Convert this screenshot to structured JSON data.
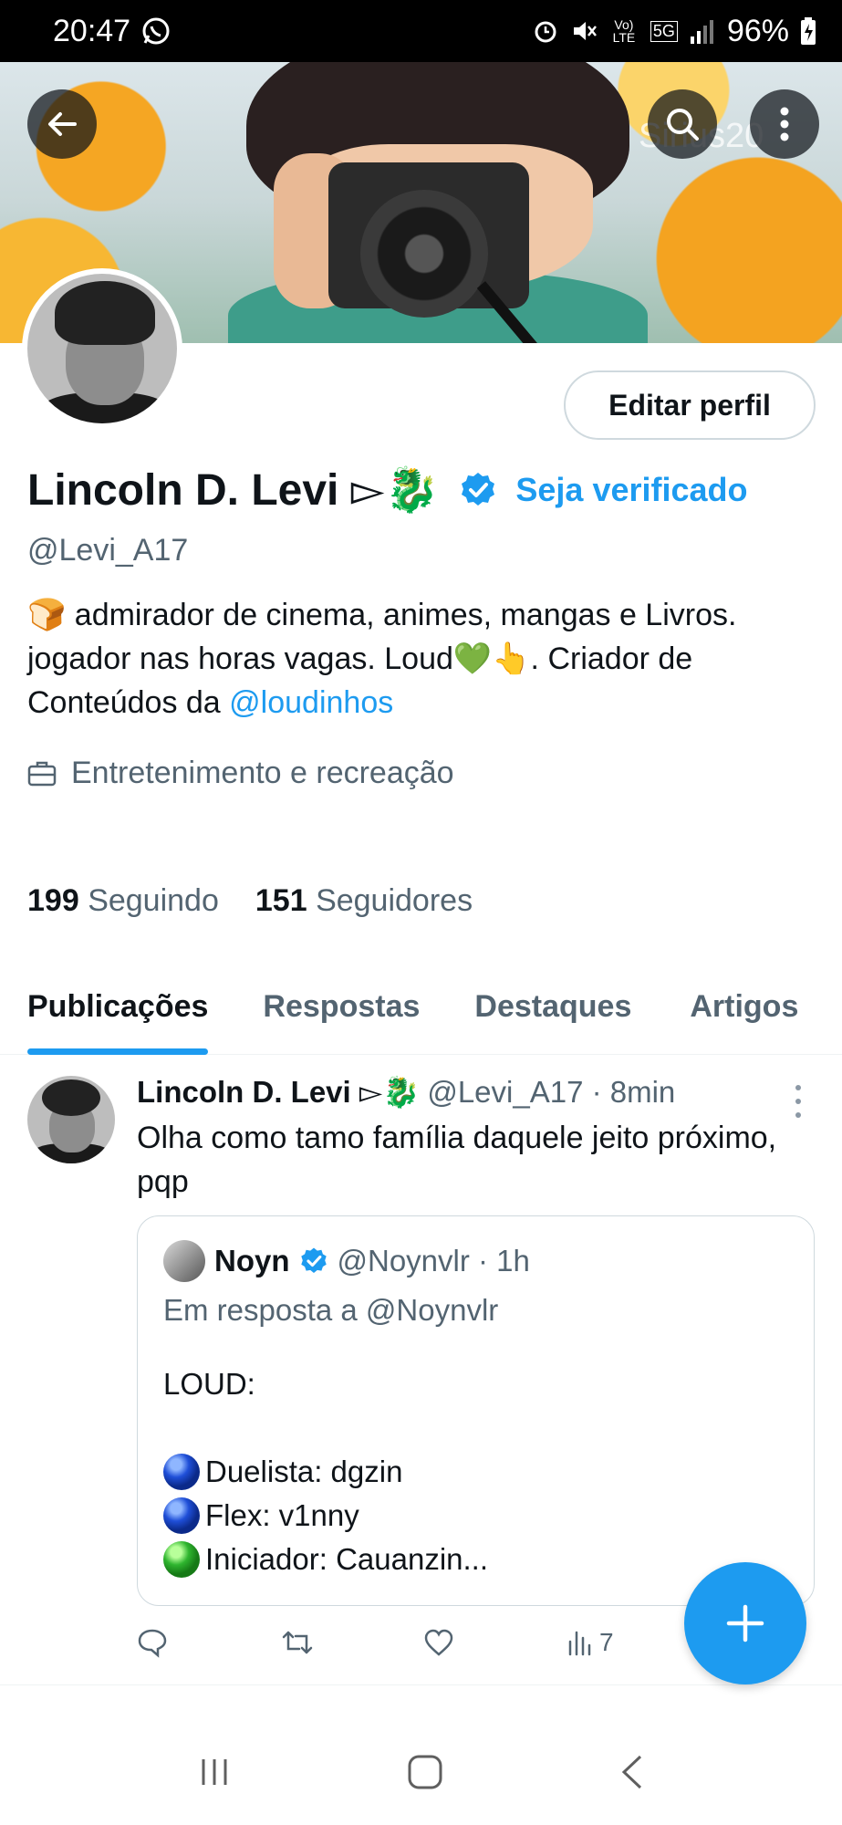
{
  "status_bar": {
    "time": "20:47",
    "battery": "96%",
    "network_lines": [
      "Vo) LTE",
      "5G"
    ]
  },
  "banner": {
    "watermark": "Sirius20"
  },
  "profile": {
    "edit_button": "Editar perfil",
    "name": "Lincoln D. Levi ▻🐉",
    "verify_link": "Seja verificado",
    "handle": "@Levi_A17",
    "bio_part1": "🍞 admirador de cinema, animes, mangas e Livros. jogador nas horas vagas. Loud💚👆. Criador de Conteúdos da ",
    "bio_mention": "@loudinhos",
    "category": "Entretenimento e recreação",
    "following_count": "199",
    "following_label": "Seguindo",
    "followers_count": "151",
    "followers_label": "Seguidores"
  },
  "tabs": [
    {
      "label": "Publicações",
      "active": true
    },
    {
      "label": "Respostas",
      "active": false
    },
    {
      "label": "Destaques",
      "active": false
    },
    {
      "label": "Artigos",
      "active": false
    }
  ],
  "post": {
    "author_name": "Lincoln D. Levi ▻🐉",
    "meta": "@Levi_A17 · 8min",
    "text": "Olha como tamo família daquele jeito próximo, pqp",
    "quote": {
      "author_name": "Noyn",
      "meta": "@Noynvlr · 1h",
      "reply_to": "Em resposta a @Noynvlr",
      "header_line": "LOUD:",
      "lines": [
        {
          "dot": "blue",
          "text": "Duelista: dgzin"
        },
        {
          "dot": "blue",
          "text": "Flex: v1nny"
        },
        {
          "dot": "green",
          "text": "Iniciador: Cauanzin..."
        }
      ]
    },
    "views": "7"
  },
  "colors": {
    "accent": "#1d9bf0",
    "text_primary": "#0f1419",
    "text_secondary": "#536471"
  }
}
